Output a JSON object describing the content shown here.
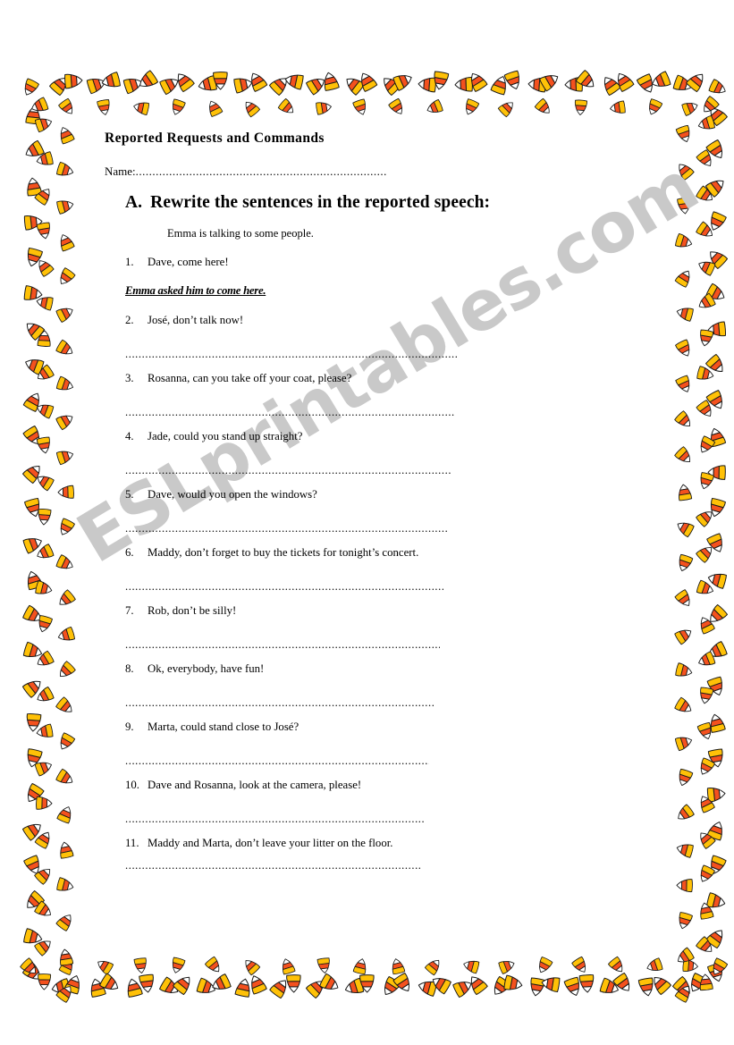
{
  "document": {
    "title": "Reported Requests and Commands",
    "name_label": "Name:",
    "name_dots": "...........................................................................",
    "section_letter": "A.",
    "section_heading": "Rewrite the sentences in the reported speech:",
    "intro": "Emma is talking to some people."
  },
  "watermark": {
    "text": "ESLprintables.com",
    "color": "#c9c9c9"
  },
  "colors": {
    "candy_tip": "#ffffff",
    "candy_middle": "#f4511e",
    "candy_base": "#ffc107",
    "candy_outline": "#1a1a1a",
    "text": "#000000"
  },
  "exercise": {
    "items": [
      {
        "number": "1.",
        "sentence": "Dave, come here!",
        "answer": "Emma asked him to come here.",
        "blank": "",
        "blank_width": 0
      },
      {
        "number": "2.",
        "sentence": "José, don’t talk now!",
        "answer": "",
        "blank": "........................................................................................................",
        "blank_width": 372
      },
      {
        "number": "3.",
        "sentence": "Rosanna, can you take off your coat, please?",
        "answer": "",
        "blank": "........................................................................................................",
        "blank_width": 368
      },
      {
        "number": "4.",
        "sentence": "Jade, could you stand up straight?",
        "answer": "",
        "blank": "........................................................................................................",
        "blank_width": 364
      },
      {
        "number": "5.",
        "sentence": "Dave, would you open the windows?",
        "answer": "",
        "blank": "........................................................................................................",
        "blank_width": 360
      },
      {
        "number": "6.",
        "sentence": "Maddy, don’t forget to buy the tickets for tonight’s concert.",
        "answer": "",
        "blank": "........................................................................................................",
        "blank_width": 356
      },
      {
        "number": "7.",
        "sentence": "Rob, don’t be silly!",
        "answer": "",
        "blank": "........................................................................................................",
        "blank_width": 352
      },
      {
        "number": "8.",
        "sentence": "Ok, everybody, have fun!",
        "answer": "",
        "blank": "........................................................................................................",
        "blank_width": 345
      },
      {
        "number": "9.",
        "sentence": "Marta, could stand close to José?",
        "answer": "",
        "blank": "........................................................................................................",
        "blank_width": 340
      },
      {
        "number": "10.",
        "sentence": "Dave and Rosanna, look at the camera, please!",
        "answer": "",
        "blank": "........................................................................................................",
        "blank_width": 336
      },
      {
        "number": "11.",
        "sentence": "Maddy and Marta, don’t leave your litter on the floor.",
        "answer": "",
        "blank": "........................................................................................................",
        "blank_width": 330
      }
    ]
  }
}
